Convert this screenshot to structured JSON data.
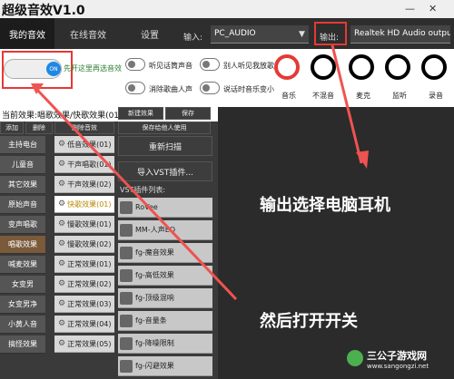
{
  "app": {
    "title": "超级音效V1.0"
  },
  "nav": {
    "tabs": [
      "我的音效",
      "在线音效",
      "设置"
    ],
    "input_label": "输入:",
    "input_value": "PC_AUDIO",
    "output_label": "输出:",
    "output_value": "Realtek HD Audio output"
  },
  "toggles": {
    "main_switch_state": "ON",
    "main_hint": "先开这里再选音效",
    "opt1": "听见话筒声音",
    "opt2": "消除歌曲人声",
    "opt3": "别人听见我放歌",
    "opt4": "说话时音乐变小"
  },
  "knobs": [
    {
      "label": "音乐",
      "color": "#1e88e5"
    },
    {
      "label": "不混音",
      "color": "#fb8c00"
    },
    {
      "label": "麦克",
      "color": "#e53935"
    },
    {
      "label": "监听",
      "color": "#8d6e63"
    },
    {
      "label": "录音",
      "color": "#e53935"
    }
  ],
  "panel": {
    "header": "当前效果:唱歌效果/快歌效果(01)",
    "add": "添加",
    "delete": "删除",
    "delete_effect": "删除音效",
    "new_effect": "新建效果",
    "save": "保存",
    "save_for_others": "保存给他人使用",
    "rescan": "重新扫描",
    "import_vst": "导入VST插件...",
    "vst_list_title": "VST插件列表:"
  },
  "categories": [
    "主持电台",
    "儿童音",
    "其它效果",
    "原始声音",
    "变声唱歌",
    "唱歌效果",
    "喊麦效果",
    "女变男",
    "女变男净",
    "小黄人音",
    "搞怪效果"
  ],
  "selected_category": "唱歌效果",
  "effects": [
    "低音效果(01)",
    "干声唱歌(01)",
    "干声效果(02)",
    "快歌效果(01)",
    "慢歌效果(01)",
    "慢歌效果(02)",
    "正常效果(01)",
    "正常效果(02)",
    "正常效果(03)",
    "正常效果(04)",
    "正常效果(05)"
  ],
  "highlighted_effect": "快歌效果(01)",
  "vst_plugins": [
    "RoVee",
    "MM-人声EQ",
    "fg-魔音效果",
    "fg-高低效果",
    "fg-顶级混响",
    "fg-音量条",
    "fg-降噪限制",
    "fg-闪避效果"
  ],
  "annotations": {
    "output": "输出选择电脑耳机",
    "switch": "然后打开开关"
  },
  "watermark": {
    "name": "三公子游戏网",
    "url": "www.sangongzi.net"
  },
  "colors": {
    "highlight_box": "#e53935",
    "arrow": "#ef5350"
  }
}
